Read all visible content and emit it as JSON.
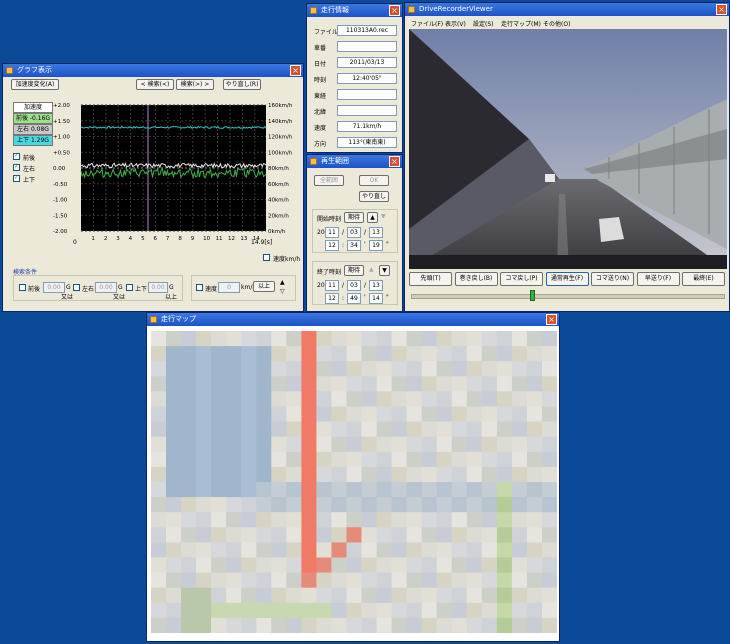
{
  "graph": {
    "title": "グラフ表示",
    "accel_change_btn": "加速度変化(A)",
    "search_prev_btn": "< 検索(<)",
    "search_next_btn": "検索(>) >",
    "redo_btn": "やり直し(R)",
    "legend_title": "加速度",
    "legend_fb": "前後 -0.16G",
    "legend_lr": "左右 0.08G",
    "legend_ud": "上下 1.29G",
    "check_fb": "前後",
    "check_lr": "左右",
    "check_ud": "上下",
    "y_left_ticks": [
      "+2.00",
      "+1.50",
      "+1.00",
      "+0.50",
      "0.00",
      "-0.50",
      "-1.00",
      "-1.50",
      "-2.00"
    ],
    "y_right_ticks": [
      "160km/h",
      "140km/h",
      "120km/h",
      "100km/h",
      "80km/h",
      "60km/h",
      "40km/h",
      "20km/h",
      "0km/h"
    ],
    "x_ticks": [
      "1",
      "2",
      "3",
      "4",
      "5",
      "6",
      "7",
      "8",
      "9",
      "10",
      "11",
      "12",
      "13",
      "14"
    ],
    "x_origin": "0",
    "x_end": "14.9[s]",
    "speed_check": "速度km/h",
    "search_cond_title": "検索条件",
    "cond_fb": "前後",
    "cond_lr": "左右",
    "cond_ud": "上下",
    "cond_speed": "速度",
    "cond_val": "0.00",
    "cond_speed_val": "0",
    "unit_g": "G",
    "unit_kmh": "km/h",
    "or_text": "又は",
    "or_more_text": "以上",
    "above_btn": "以上",
    "colors": {
      "fb": "#3ab54a",
      "lr": "#e0e0e0",
      "ud": "#27c6c6",
      "marker": "#c080d0"
    }
  },
  "info": {
    "title": "走行情報",
    "rows": [
      {
        "label": "ファイル",
        "value": "110313A0.rec"
      },
      {
        "label": "車番",
        "value": ""
      },
      {
        "label": "日付",
        "value": "2011/03/13"
      },
      {
        "label": "時刻",
        "value": "12:40'05\""
      },
      {
        "label": "東経",
        "value": ""
      },
      {
        "label": "北緯",
        "value": ""
      },
      {
        "label": "速度",
        "value": "71.1km/h"
      },
      {
        "label": "方向",
        "value": "113°(東南東)"
      }
    ]
  },
  "range": {
    "title": "再生範囲",
    "all_btn": "全範囲",
    "ok_btn": "OK",
    "redo_btn": "やり直し",
    "start_label": "開始時刻",
    "end_label": "終了時刻",
    "period_btn": "期待",
    "start_year_prefix": "20",
    "start_year": "11",
    "start_month": "03",
    "start_day": "13",
    "start_h": "12",
    "start_m": "34",
    "start_s": "19",
    "end_year": "11",
    "end_month": "03",
    "end_day": "13",
    "end_h": "12",
    "end_m": "49",
    "end_s": "14",
    "slash": "/",
    "colon": ":",
    "quote": "'",
    "dquote": "\""
  },
  "viewer": {
    "title": "DriveRecorderViewer",
    "menu": [
      "ファイル(F)",
      "表示(V)",
      "設定(S)",
      "走行マップ(M)",
      "その他(O)"
    ],
    "controls": [
      "先頭(T)",
      "巻き戻し(B)",
      "コマ戻し(P)",
      "通常再生(F)",
      "コマ送り(N)",
      "早送り(F)",
      "最終(E)"
    ],
    "seek_fraction": 0.38
  },
  "map": {
    "title": "走行マップ"
  }
}
